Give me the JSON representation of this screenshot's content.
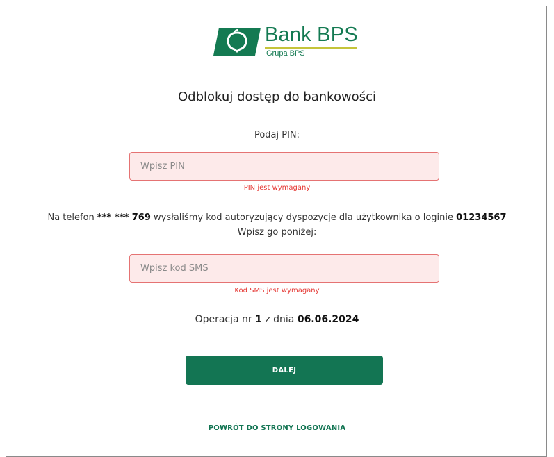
{
  "brand": {
    "name": "Bank BPS",
    "subtitle": "Grupa BPS",
    "logo_icon": "bps-logo-icon",
    "color_primary": "#137553",
    "color_accent": "#c5c43a"
  },
  "page": {
    "title": "Odblokuj dostęp do bankowości"
  },
  "pin": {
    "label": "Podaj PIN:",
    "placeholder": "Wpisz PIN",
    "value": "",
    "error": "PIN jest wymagany"
  },
  "sms_info": {
    "prefix": "Na telefon ",
    "phone": "*** *** 769",
    "middle": " wysłaliśmy kod autoryzujący dyspozycje dla użytkownika o loginie ",
    "login": "01234567",
    "line2": "Wpisz go poniżej:"
  },
  "sms": {
    "placeholder": "Wpisz kod SMS",
    "value": "",
    "error": "Kod SMS jest wymagany"
  },
  "operation": {
    "prefix": "Operacja nr ",
    "number": "1",
    "middle": "z dnia ",
    "date": "06.06.2024"
  },
  "actions": {
    "next_label": "DALEJ",
    "back_label": "POWRÓT DO STRONY LOGOWANIA"
  },
  "colors": {
    "error": "#e53935",
    "field_border_error": "#e57373",
    "field_bg_error": "#fdeaea"
  }
}
